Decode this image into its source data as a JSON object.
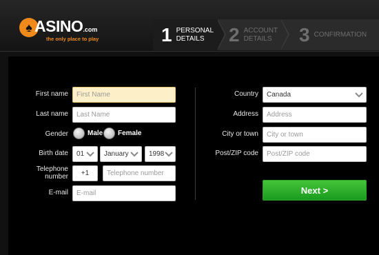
{
  "logo": {
    "initial": "C",
    "word": "ASINO",
    "tld": ".com",
    "tagline": "the only place to play"
  },
  "steps": [
    {
      "num": "1",
      "label_line1": "PERSONAL",
      "label_line2": "DETAILS",
      "active": true
    },
    {
      "num": "2",
      "label_line1": "ACCOUNT",
      "label_line2": "DETAILS",
      "active": false
    },
    {
      "num": "3",
      "label_line1": "CONFIRMATION",
      "label_line2": "",
      "active": false
    }
  ],
  "form": {
    "first_name": {
      "label": "First name",
      "placeholder": "First Name",
      "value": ""
    },
    "last_name": {
      "label": "Last name",
      "placeholder": "Last Name",
      "value": ""
    },
    "gender": {
      "label": "Gender",
      "male": "Male",
      "female": "Female"
    },
    "birth_date": {
      "label": "Birth date",
      "day": "01",
      "month": "January",
      "year": "1998"
    },
    "telephone": {
      "label_line1": "Telephone",
      "label_line2": "number",
      "prefix": "+1",
      "placeholder": "Telephone number"
    },
    "email": {
      "label": "E-mail",
      "placeholder": "E-mail"
    },
    "country": {
      "label": "Country",
      "value": "Canada"
    },
    "address": {
      "label": "Address",
      "placeholder": "Address"
    },
    "city": {
      "label": "City or town",
      "placeholder": "City or town"
    },
    "postal": {
      "label": "Post/ZIP code",
      "placeholder": "Post/ZIP code"
    },
    "next_button": "Next >"
  },
  "colors": {
    "accent_green": "#2aa62a",
    "logo_orange": "#f08a1a",
    "focus_bg": "#fdf0c8"
  }
}
